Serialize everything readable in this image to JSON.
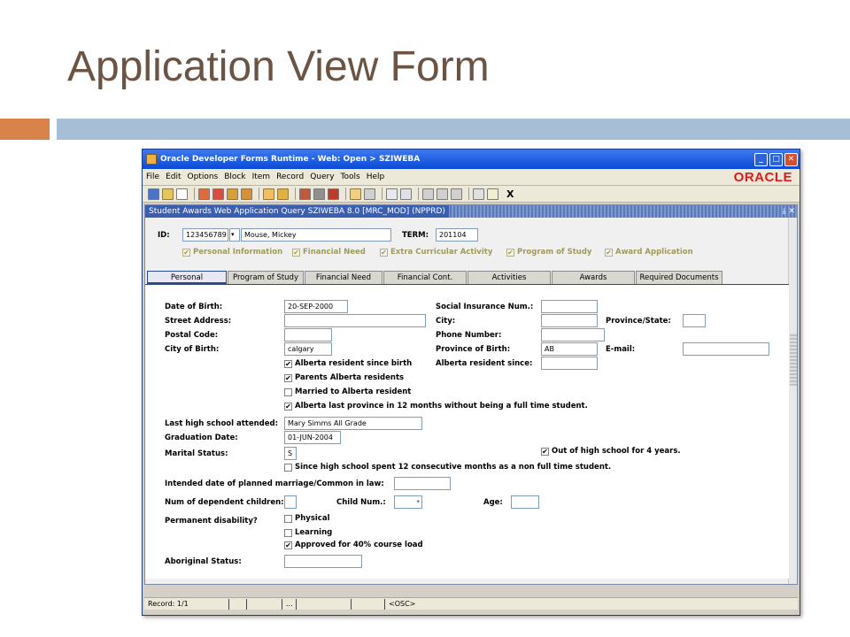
{
  "slide": {
    "title": "Application View Form"
  },
  "window": {
    "title": "Oracle Developer Forms Runtime - Web:  Open > SZIWEBA",
    "logo": "ORACLE",
    "menu": [
      "File",
      "Edit",
      "Options",
      "Block",
      "Item",
      "Record",
      "Query",
      "Tools",
      "Help"
    ],
    "toolbar_x": "X"
  },
  "form": {
    "title": "Student Awards Web Application Query  SZIWEBA  8.0  [MRC_MOD]  (NPPRD)",
    "id_label": "ID:",
    "id_value": "123456789",
    "name_value": "Mouse, Mickey",
    "term_label": "TERM:",
    "term_value": "201104",
    "nav_checks": [
      "Personal Information",
      "Financial Need",
      "Extra Curricular Activity",
      "Program of Study",
      "Award Application"
    ],
    "tabs": [
      "Personal",
      "Program of Study",
      "Financial Need",
      "Financial Cont.",
      "Activities",
      "Awards",
      "Required Documents"
    ]
  },
  "personal": {
    "dob_label": "Date of Birth:",
    "dob_value": "20-SEP-2000",
    "street_label": "Street Address:",
    "postal_label": "Postal Code:",
    "city_birth_label": "City of Birth:",
    "city_birth_value": "calgary",
    "sin_label": "Social Insurance Num.:",
    "city_label": "City:",
    "prov_state_label": "Province/State:",
    "phone_label": "Phone Number:",
    "prov_birth_label": "Province of Birth:",
    "prov_birth_value": "AB",
    "email_label": "E-mail:",
    "ab_since_label": "Alberta resident since:",
    "checks": [
      {
        "label": "Alberta resident since birth",
        "checked": true
      },
      {
        "label": "Parents Alberta residents",
        "checked": true
      },
      {
        "label": "Married to Alberta resident",
        "checked": false
      },
      {
        "label": "Alberta last province in 12 months without being a full time student.",
        "checked": true
      }
    ],
    "hs_label": "Last high school attended:",
    "hs_value": "Mary Simms All Grade",
    "grad_label": "Graduation Date:",
    "grad_value": "01-JUN-2004",
    "marital_label": "Marital Status:",
    "marital_value": "S",
    "out_hs_label": "Out of high school for 4 years.",
    "since_hs_label": "Since high school spent 12 consecutive months as a non full time student.",
    "marriage_label": "Intended date of planned marriage/Common in law:",
    "dependents_label": "Num of dependent children:",
    "child_num_label": "Child Num.:",
    "age_label": "Age:",
    "disability_label": "Permanent disability?",
    "disability_checks": [
      {
        "label": "Physical",
        "checked": false
      },
      {
        "label": "Learning",
        "checked": false
      },
      {
        "label": "Approved for 40% course load",
        "checked": true
      }
    ],
    "aboriginal_label": "Aboriginal Status:"
  },
  "status": {
    "record": "Record: 1/1",
    "dots": "...",
    "osc": "<OSC>"
  }
}
